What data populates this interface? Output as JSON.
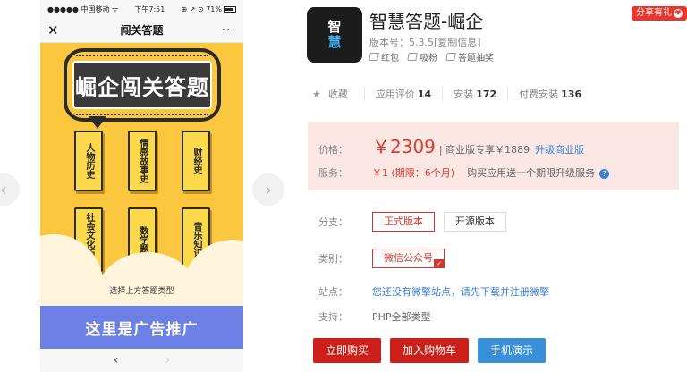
{
  "phone": {
    "status_left": "●●●●● 中国移动 ᯤ",
    "status_time": "下午7:51",
    "status_right": "⊕ ↗ ⊙ 71%",
    "header_close": "✕",
    "header_title": "闯关答题",
    "header_more": "···",
    "banner_text": "崛企闯关答题",
    "categories": [
      "人物历史",
      "情感故事史",
      "财经史",
      "社会文化历史",
      "数学题",
      "音乐知识"
    ],
    "hint": "选择上方答题类型",
    "ad_text": "这里是广告推广",
    "back": "‹",
    "forward": "›"
  },
  "gallery": {
    "prev": "‹",
    "next": "›"
  },
  "product": {
    "logo_line1": "智",
    "logo_line2": "慧",
    "title": "智慧答题-崛企",
    "version": "版本号：5.3.5[复制信息]",
    "tags": [
      "红包",
      "吸粉",
      "答题抽奖"
    ],
    "share": "分享有礼"
  },
  "stats": {
    "favorite": "收藏",
    "rating_label": "应用评价",
    "rating_value": "14",
    "install_label": "安装",
    "install_value": "172",
    "paid_label": "付费安装",
    "paid_value": "136"
  },
  "pricing": {
    "price_label": "价格：",
    "price": "￥2309",
    "biz_price": "| 商业版专享￥1889",
    "upgrade": "升级商业版",
    "service_label": "服务：",
    "service_price": "￥1 (期限：6个月)",
    "service_note": "购买应用送一个期限升级服务"
  },
  "branch": {
    "label": "分支：",
    "options": [
      "正式版本",
      "开源版本"
    ]
  },
  "category": {
    "label": "类别：",
    "value": "微信公众号"
  },
  "site": {
    "label": "站点：",
    "value": "您还没有微擎站点，请先下载并注册微擎"
  },
  "support": {
    "label": "支持：",
    "value": "PHP全部类型"
  },
  "actions": {
    "buy": "立即购买",
    "cart": "加入购物车",
    "demo": "手机演示"
  },
  "colors": {
    "accent_red": "#cc1f1a",
    "link_blue": "#3a7fd5",
    "phone_yellow": "#fbc73e",
    "ad_blue": "#6d80e6"
  }
}
